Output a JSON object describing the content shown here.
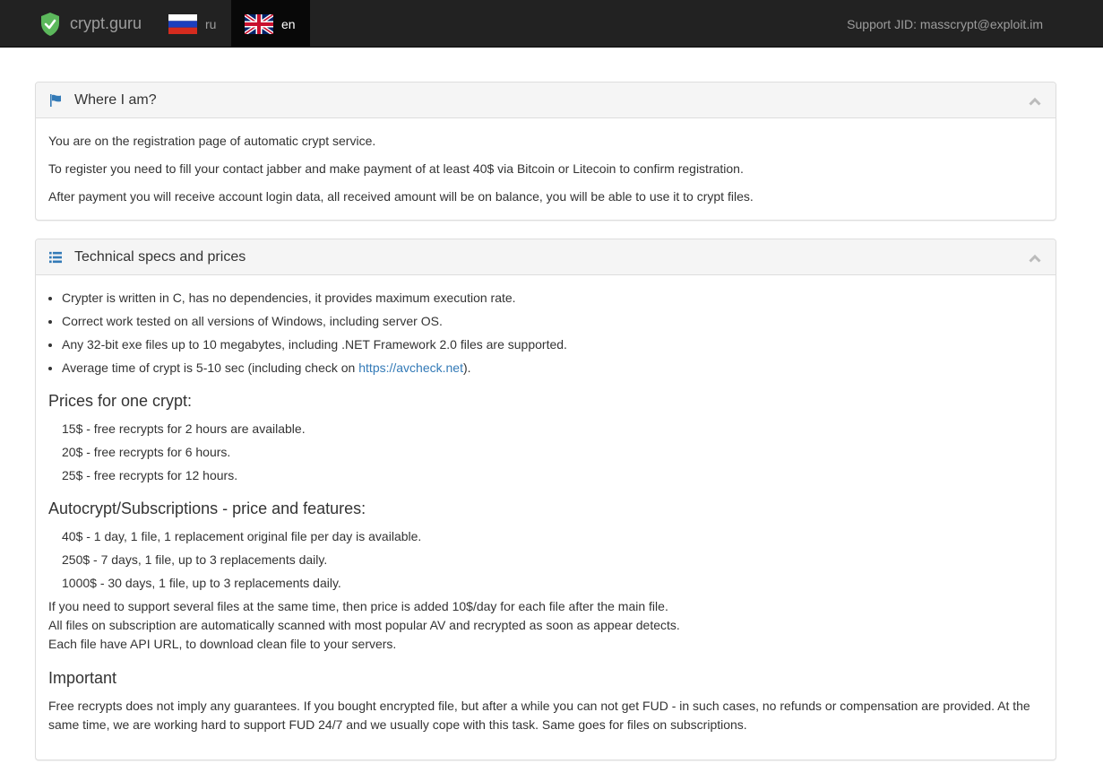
{
  "nav": {
    "brand": "crypt.guru",
    "lang_ru": "ru",
    "lang_en": "en",
    "support": "Support JID: masscrypt@exploit.im"
  },
  "where": {
    "title": "Where I am?",
    "p1": "You are on the registration page of automatic crypt service.",
    "p2": "To register you need to fill your contact jabber and make payment of at least 40$ via Bitcoin or Litecoin to confirm registration.",
    "p3": "After payment you will receive account login data, all received amount will be on balance, you will be able to use it to crypt files."
  },
  "specs": {
    "title": "Technical specs and prices",
    "bullets": [
      "Crypter is written in C, has no dependencies, it provides maximum execution rate.",
      "Correct work tested on all versions of Windows, including server OS.",
      "Any 32-bit exe files up to 10 megabytes, including .NET Framework 2.0 files are supported."
    ],
    "bullet4_pre": "Average time of crypt is 5-10 sec (including check on ",
    "bullet4_link": "https://avcheck.net",
    "bullet4_post": ").",
    "prices_heading": "Prices for one crypt:",
    "prices": [
      "15$ - free recrypts for 2 hours are available.",
      "20$ - free recrypts for 6 hours.",
      "25$ - free recrypts for 12 hours."
    ],
    "auto_heading": "Autocrypt/Subscriptions - price and features:",
    "auto": [
      "40$ - 1 day, 1 file, 1 replacement original file per day is available.",
      "250$ - 7 days, 1 file, up to 3 replacements daily.",
      "1000$ - 30 days, 1 file, up to 3 replacements daily."
    ],
    "notes": [
      "If you need to support several files at the same time, then price is added 10$/day for each file after the main file.",
      "All files on subscription are automatically scanned with most popular AV and recrypted as soon as appear detects.",
      "Each file have API URL, to download clean file to your servers."
    ],
    "important_heading": "Important",
    "important_text": "Free recrypts does not imply any guarantees. If you bought encrypted file, but after a while you can not get FUD - in such cases, no refunds or compensation are provided. At the same time, we are working hard to support FUD 24/7 and we usually cope with this task. Same goes for files on subscriptions."
  },
  "colors": {
    "navbar": "#222222",
    "active_lang": "#080808",
    "shield": "#5cb85c",
    "icon": "#337ab7",
    "link": "#337ab7"
  }
}
